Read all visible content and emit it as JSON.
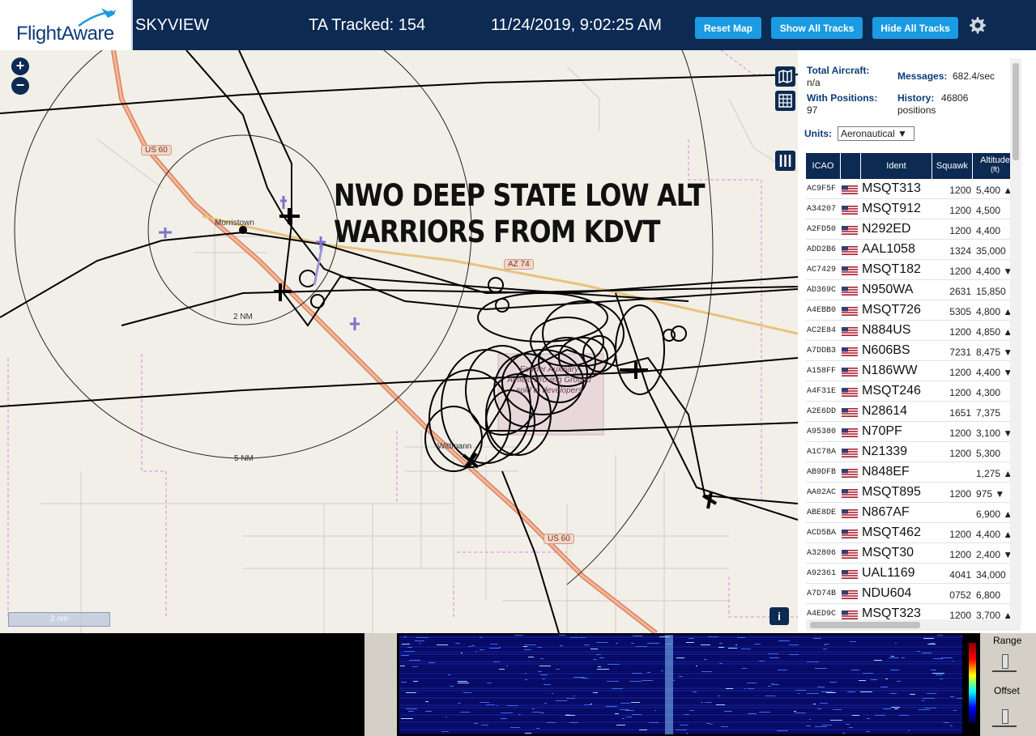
{
  "header": {
    "logo_text": "FlightAware",
    "app_name": "SKYVIEW",
    "tracked": "TA Tracked: 154",
    "datetime": "11/24/2019, 9:02:25 AM",
    "buttons": {
      "reset_map": "Reset Map",
      "show_all": "Show All Tracks",
      "hide_all": "Hide All Tracks"
    },
    "settings_icon": "gear-icon"
  },
  "map": {
    "zoom_in": "+",
    "zoom_out": "−",
    "overlay_line1": "NWO DEEP STATE LOW ALT",
    "overlay_line2": "WARRIORS FROM KDVT",
    "town_morristown": "Morristown",
    "town_wittmann": "Wittmann",
    "ring_2nm": "2 NM",
    "ring_5nm": "5 NM",
    "shield_us60_a": "US 60",
    "shield_az74": "AZ 74",
    "shield_us60_b": "US 60",
    "airfield_label": "Former Auxiliary Airfield Proving Ground sold to developers",
    "scale": "2 nm",
    "info": "i",
    "colors": {
      "land": "#f2efe9",
      "track": "#000000",
      "highway": "#e8956b"
    }
  },
  "panel": {
    "total_aircraft_label": "Total Aircraft:",
    "total_aircraft_value": "n/a",
    "messages_label": "Messages:",
    "messages_value": "682.4/sec",
    "positions_label": "With Positions:",
    "positions_value": "97",
    "history_label": "History:",
    "history_value": "46806",
    "history_unit": "positions",
    "units_label": "Units:",
    "units_value": "Aeronautical ▼",
    "columns": {
      "icao": "ICAO",
      "ident": "Ident",
      "squawk": "Squawk",
      "altitude": "Altitude",
      "altitude_unit": "(ft)"
    },
    "rows": [
      {
        "icao": "AC9F5F",
        "ident": "MSQT313",
        "squawk": "1200",
        "alt": "5,400 ▲"
      },
      {
        "icao": "A34207",
        "ident": "MSQT912",
        "squawk": "1200",
        "alt": "4,500"
      },
      {
        "icao": "A2FD50",
        "ident": "N292ED",
        "squawk": "1200",
        "alt": "4,400"
      },
      {
        "icao": "ADD2B6",
        "ident": "AAL1058",
        "squawk": "1324",
        "alt": "35,000"
      },
      {
        "icao": "AC7429",
        "ident": "MSQT182",
        "squawk": "1200",
        "alt": "4,400 ▼"
      },
      {
        "icao": "AD369C",
        "ident": "N950WA",
        "squawk": "2631",
        "alt": "15,850"
      },
      {
        "icao": "A4EBB0",
        "ident": "MSQT726",
        "squawk": "5305",
        "alt": "4,800 ▲"
      },
      {
        "icao": "AC2E84",
        "ident": "N884US",
        "squawk": "1200",
        "alt": "4,850 ▲"
      },
      {
        "icao": "A7DDB3",
        "ident": "N606BS",
        "squawk": "7231",
        "alt": "8,475 ▼"
      },
      {
        "icao": "A158FF",
        "ident": "N186WW",
        "squawk": "1200",
        "alt": "4,400 ▼"
      },
      {
        "icao": "A4F31E",
        "ident": "MSQT246",
        "squawk": "1200",
        "alt": "4,300"
      },
      {
        "icao": "A2E6DD",
        "ident": "N28614",
        "squawk": "1651",
        "alt": "7,375"
      },
      {
        "icao": "A95380",
        "ident": "N70PF",
        "squawk": "1200",
        "alt": "3,100 ▼"
      },
      {
        "icao": "A1C78A",
        "ident": "N21339",
        "squawk": "1200",
        "alt": "5,300"
      },
      {
        "icao": "AB9DFB",
        "ident": "N848EF",
        "squawk": "",
        "alt": "1,275 ▲"
      },
      {
        "icao": "AA02AC",
        "ident": "MSQT895",
        "squawk": "1200",
        "alt": "975 ▼"
      },
      {
        "icao": "ABE8DE",
        "ident": "N867AF",
        "squawk": "",
        "alt": "6,900 ▲"
      },
      {
        "icao": "ACD5BA",
        "ident": "MSQT462",
        "squawk": "1200",
        "alt": "4,400 ▲"
      },
      {
        "icao": "A32806",
        "ident": "MSQT30",
        "squawk": "1200",
        "alt": "2,400 ▼"
      },
      {
        "icao": "A92361",
        "ident": "UAL1169",
        "squawk": "4041",
        "alt": "34,000"
      },
      {
        "icao": "A7D74B",
        "ident": "NDU604",
        "squawk": "0752",
        "alt": "6,800"
      },
      {
        "icao": "A4ED9C",
        "ident": "MSQT323",
        "squawk": "1200",
        "alt": "3,700 ▲"
      }
    ]
  },
  "spectrum": {
    "range_label": "Range",
    "offset_label": "Offset"
  }
}
